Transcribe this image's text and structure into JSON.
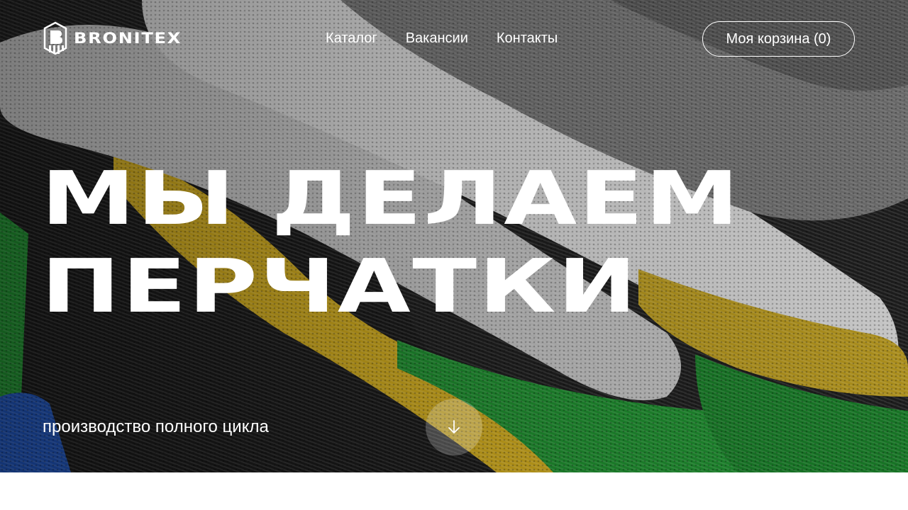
{
  "brand": {
    "name": "BRONITEX",
    "logo_icon": "bronitex-logo-icon"
  },
  "nav": {
    "items": [
      {
        "label": "Каталог"
      },
      {
        "label": "Вакансии"
      },
      {
        "label": "Контакты"
      }
    ]
  },
  "cart": {
    "label": "Моя корзина (0)"
  },
  "hero": {
    "title_line1": "МЫ ДЕЛАЕМ",
    "title_line2": "ПЕРЧАТКИ",
    "subtitle": "производство полного цикла",
    "scroll_icon": "arrow-down-icon"
  },
  "colors": {
    "text": "#ffffff",
    "glove_grey": "#9a9a9a",
    "glove_yellow": "#c9a51c",
    "glove_green": "#1e8a2e",
    "glove_blue": "#1d4fb0",
    "glove_black": "#1a1a1a",
    "page_bg": "#ffffff"
  }
}
